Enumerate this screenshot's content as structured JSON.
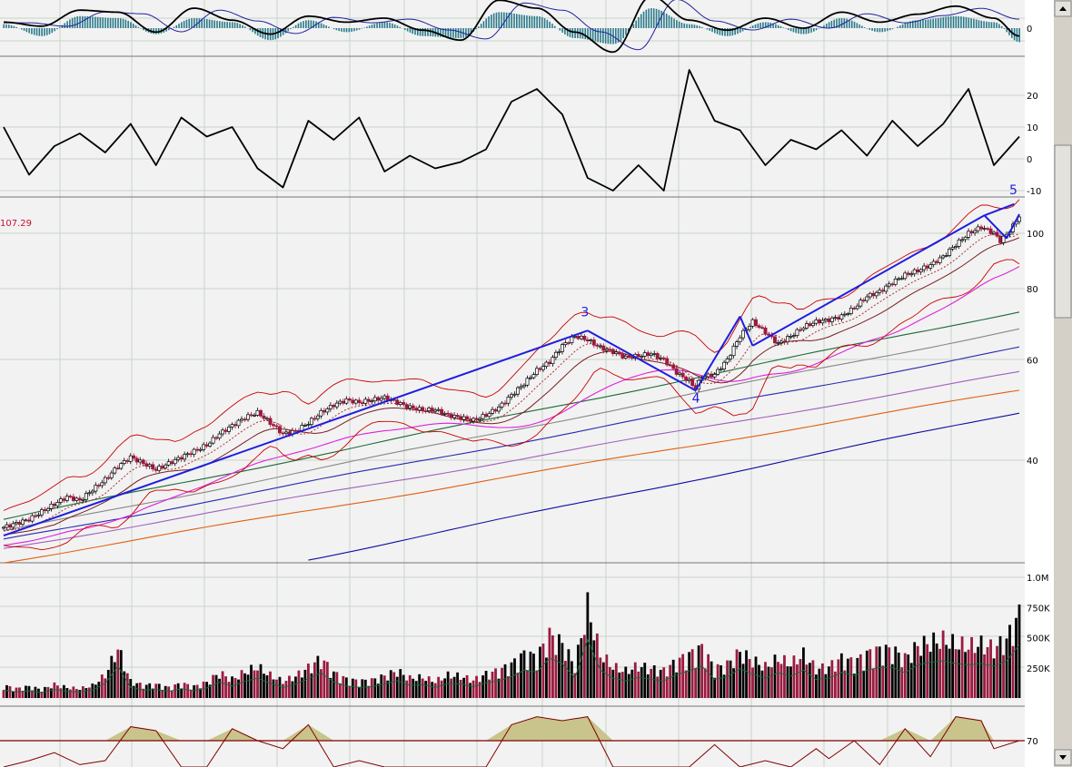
{
  "colors": {
    "background": "#f2f2f2",
    "grid": "#c8d4c8",
    "bull": "#000000",
    "bear": "#9b1b40",
    "trendline": "#1e1ee0",
    "bollinger": "#cc0000",
    "ma_short": "#7a1e1e",
    "ma_pink": "#dd22dd",
    "ma_green": "#1b6b3a",
    "ma_gray": "#888888",
    "ma_navy": "#2a2ab0",
    "ma_violet": "#a060c0",
    "ma_orange": "#e06010",
    "ma_blue": "#1010a0",
    "rsi_fill": "#c8c48c",
    "rsi_line": "#800000",
    "macd_hist": "#2a7a8a",
    "macd_signal": "#2020a0",
    "scroll_track": "#d4d0c8"
  },
  "chart_data": [
    {
      "type": "bar",
      "panel": "macd",
      "yticks": [
        "0"
      ],
      "x_days": [
        0,
        60,
        120,
        180,
        240,
        300,
        360,
        420,
        480,
        540,
        600,
        660,
        720,
        780,
        840,
        900,
        960,
        1020,
        1080,
        1140,
        1200,
        1260,
        1320,
        1380,
        1440,
        1500,
        1560,
        1600
      ],
      "histogram": [
        0.2,
        -0.4,
        0.6,
        0.5,
        -0.3,
        0.5,
        0.3,
        -0.6,
        0.4,
        -0.2,
        0.3,
        -0.4,
        -0.5,
        0.8,
        0.6,
        -0.5,
        -0.8,
        1.0,
        0.2,
        -0.4,
        0.3,
        -0.3,
        0.5,
        -0.2,
        0.4,
        0.6,
        0.3,
        -0.7
      ],
      "macd": [
        0.3,
        0.1,
        0.9,
        0.8,
        -0.2,
        1.0,
        0.4,
        -0.3,
        0.6,
        0.3,
        0.5,
        -0.1,
        -0.6,
        1.4,
        1.0,
        -0.2,
        -1.2,
        1.6,
        0.4,
        -0.1,
        0.5,
        0.0,
        0.8,
        0.3,
        0.7,
        1.1,
        0.5,
        -0.4
      ]
    },
    {
      "type": "line",
      "panel": "momentum",
      "yticks": [
        "20",
        "10",
        "0",
        "-10"
      ],
      "ylim": [
        -10,
        25
      ],
      "x_days": [
        0,
        40,
        80,
        120,
        160,
        200,
        240,
        280,
        320,
        360,
        400,
        440,
        480,
        520,
        560,
        600,
        640,
        680,
        720,
        760,
        800,
        840,
        880,
        920,
        960,
        1000,
        1040,
        1080,
        1120,
        1160,
        1200,
        1240,
        1280,
        1320,
        1360,
        1400,
        1440,
        1480,
        1520,
        1560,
        1600
      ],
      "values": [
        10,
        -5,
        4,
        8,
        2,
        11,
        -2,
        13,
        7,
        10,
        -3,
        -9,
        12,
        6,
        13,
        -4,
        1,
        -3,
        -1,
        3,
        18,
        22,
        14,
        -6,
        -10,
        -2,
        -10,
        28,
        12,
        9,
        -2,
        6,
        3,
        9,
        1,
        12,
        4,
        11,
        22,
        -2,
        7
      ]
    },
    {
      "type": "line",
      "panel": "price",
      "scale": "log",
      "ylim": [
        32,
        118
      ],
      "yticks": [
        "100",
        "80",
        "60",
        "40"
      ],
      "last_price_label": "107.29",
      "close": [
        [
          0,
          30.5
        ],
        [
          20,
          31
        ],
        [
          40,
          31.5
        ],
        [
          60,
          32.5
        ],
        [
          80,
          33.5
        ],
        [
          100,
          34.5
        ],
        [
          120,
          34.0
        ],
        [
          140,
          35.5
        ],
        [
          160,
          37.0
        ],
        [
          180,
          39.0
        ],
        [
          200,
          40.5
        ],
        [
          220,
          39.5
        ],
        [
          240,
          38.5
        ],
        [
          260,
          39.5
        ],
        [
          280,
          40.5
        ],
        [
          300,
          41.5
        ],
        [
          320,
          42.5
        ],
        [
          340,
          44.5
        ],
        [
          360,
          46.0
        ],
        [
          380,
          47.5
        ],
        [
          400,
          48.5
        ],
        [
          420,
          46.5
        ],
        [
          440,
          44.5
        ],
        [
          460,
          45.0
        ],
        [
          480,
          46.5
        ],
        [
          500,
          48.5
        ],
        [
          520,
          50.0
        ],
        [
          540,
          51.0
        ],
        [
          560,
          50.5
        ],
        [
          580,
          51.0
        ],
        [
          600,
          51.5
        ],
        [
          620,
          50.5
        ],
        [
          640,
          49.5
        ],
        [
          660,
          49.0
        ],
        [
          680,
          49.0
        ],
        [
          700,
          48.0
        ],
        [
          720,
          47.5
        ],
        [
          740,
          47.0
        ],
        [
          760,
          48.0
        ],
        [
          780,
          49.5
        ],
        [
          800,
          52.0
        ],
        [
          820,
          54.5
        ],
        [
          840,
          57.5
        ],
        [
          860,
          59.5
        ],
        [
          880,
          63.5
        ],
        [
          900,
          66.0
        ],
        [
          920,
          65.0
        ],
        [
          940,
          63.0
        ],
        [
          960,
          62.0
        ],
        [
          980,
          60.5
        ],
        [
          1000,
          61.0
        ],
        [
          1020,
          61.5
        ],
        [
          1040,
          60.0
        ],
        [
          1060,
          57.0
        ],
        [
          1080,
          55.0
        ],
        [
          1090,
          53.5
        ],
        [
          1100,
          56.0
        ],
        [
          1120,
          56.5
        ],
        [
          1140,
          60.0
        ],
        [
          1160,
          66.0
        ],
        [
          1180,
          70.0
        ],
        [
          1200,
          67.0
        ],
        [
          1220,
          64.0
        ],
        [
          1240,
          66.0
        ],
        [
          1260,
          68.5
        ],
        [
          1280,
          70.0
        ],
        [
          1300,
          70.5
        ],
        [
          1320,
          71.5
        ],
        [
          1340,
          74.0
        ],
        [
          1360,
          77.5
        ],
        [
          1380,
          79.0
        ],
        [
          1400,
          82.0
        ],
        [
          1420,
          84.5
        ],
        [
          1440,
          86.0
        ],
        [
          1460,
          88.0
        ],
        [
          1480,
          91.0
        ],
        [
          1500,
          95.5
        ],
        [
          1520,
          100.0
        ],
        [
          1540,
          102.5
        ],
        [
          1560,
          100.0
        ],
        [
          1570,
          97.0
        ],
        [
          1580,
          99.5
        ],
        [
          1590,
          103.0
        ],
        [
          1600,
          107.29
        ]
      ],
      "trendlines": [
        {
          "points": [
            [
              0,
              29.5
            ],
            [
              920,
              67.5
            ]
          ]
        },
        {
          "points": [
            [
              920,
              67.5
            ],
            [
              1090,
              53.0
            ]
          ]
        },
        {
          "points": [
            [
              1090,
              53.0
            ],
            [
              1160,
              71.5
            ]
          ]
        },
        {
          "points": [
            [
              1160,
              71.5
            ],
            [
              1180,
              63.5
            ]
          ]
        },
        {
          "points": [
            [
              1180,
              63.5
            ],
            [
              1545,
              107.5
            ]
          ]
        },
        {
          "points": [
            [
              1545,
              107.5
            ],
            [
              1580,
              98.0
            ]
          ]
        },
        {
          "points": [
            [
              1580,
              98.0
            ],
            [
              1600,
              108.0
            ]
          ]
        },
        {
          "points": [
            [
              1545,
              107.5
            ],
            [
              1592,
              112.5
            ]
          ]
        }
      ],
      "wave_labels": [
        {
          "text": "3",
          "x": 915,
          "y": 71.5
        },
        {
          "text": "4",
          "x": 1090,
          "y": 50.5
        },
        {
          "text": "5",
          "x": 1590,
          "y": 117.0
        }
      ],
      "ma_long": [
        {
          "color_key": "ma_green",
          "start": [
            0,
            31.5
          ],
          "end": [
            1600,
            73.0
          ]
        },
        {
          "color_key": "ma_gray",
          "start": [
            0,
            30.0
          ],
          "end": [
            1600,
            68.0
          ]
        },
        {
          "color_key": "ma_navy",
          "start": [
            0,
            29.0
          ],
          "end": [
            1600,
            63.0
          ]
        },
        {
          "color_key": "ma_violet",
          "start": [
            0,
            28.0
          ],
          "end": [
            1600,
            57.0
          ]
        },
        {
          "color_key": "ma_orange",
          "start": [
            0,
            26.5
          ],
          "end": [
            1600,
            53.0
          ]
        },
        {
          "color_key": "ma_blue",
          "start": [
            480,
            26.8
          ],
          "end": [
            1600,
            48.5
          ]
        }
      ]
    },
    {
      "type": "bar",
      "panel": "volume",
      "ylim": [
        0,
        1100
      ],
      "yticks": [
        "1.0M",
        "750K",
        "500K",
        "250K"
      ],
      "ytick_values": [
        1000,
        750,
        500,
        250
      ],
      "x_days": [
        0,
        20,
        40,
        60,
        80,
        100,
        120,
        140,
        160,
        180,
        200,
        220,
        240,
        260,
        280,
        300,
        320,
        340,
        360,
        380,
        400,
        420,
        440,
        460,
        480,
        500,
        520,
        540,
        560,
        580,
        600,
        620,
        640,
        660,
        680,
        700,
        720,
        740,
        760,
        780,
        800,
        820,
        840,
        860,
        880,
        900,
        920,
        940,
        960,
        980,
        1000,
        1020,
        1040,
        1060,
        1080,
        1100,
        1120,
        1140,
        1160,
        1180,
        1200,
        1220,
        1240,
        1260,
        1280,
        1300,
        1320,
        1340,
        1360,
        1380,
        1400,
        1420,
        1440,
        1460,
        1480,
        1500,
        1520,
        1540,
        1560,
        1580,
        1600
      ],
      "values_k": [
        120,
        90,
        110,
        80,
        130,
        100,
        90,
        120,
        220,
        480,
        160,
        120,
        130,
        100,
        140,
        110,
        150,
        240,
        180,
        250,
        300,
        220,
        160,
        210,
        290,
        380,
        240,
        180,
        160,
        170,
        210,
        260,
        190,
        200,
        160,
        220,
        210,
        170,
        230,
        260,
        320,
        420,
        390,
        600,
        520,
        300,
        880,
        420,
        300,
        260,
        310,
        280,
        260,
        350,
        410,
        480,
        280,
        320,
        440,
        360,
        300,
        380,
        330,
        420,
        280,
        300,
        380,
        340,
        420,
        460,
        460,
        380,
        500,
        540,
        560,
        520,
        500,
        520,
        480,
        560,
        800
      ],
      "up": [
        true,
        false,
        true,
        true,
        false,
        true,
        false,
        true,
        false,
        true,
        true,
        false,
        true,
        false,
        true,
        false,
        true,
        true,
        false,
        true,
        false,
        true,
        false,
        true,
        true,
        false,
        true,
        false,
        true,
        false,
        true,
        true,
        false,
        true,
        false,
        true,
        true,
        false,
        true,
        false,
        true,
        true,
        true,
        false,
        true,
        true,
        true,
        false,
        false,
        true,
        false,
        true,
        false,
        true,
        false,
        false,
        true,
        true,
        true,
        false,
        true,
        false,
        true,
        false,
        true,
        true,
        false,
        true,
        true,
        false,
        true,
        false,
        true,
        true,
        false,
        true,
        false,
        true,
        false,
        true,
        true
      ]
    },
    {
      "type": "area",
      "panel": "rsi",
      "yticks": [
        "70"
      ],
      "threshold": 70,
      "ylim": [
        40,
        85
      ],
      "x_days": [
        0,
        40,
        80,
        120,
        160,
        200,
        240,
        280,
        320,
        360,
        400,
        440,
        480,
        520,
        560,
        600,
        640,
        680,
        720,
        760,
        800,
        840,
        880,
        920,
        960,
        1000,
        1040,
        1080,
        1120,
        1160,
        1200,
        1240,
        1280,
        1300,
        1340,
        1380,
        1420,
        1460,
        1500,
        1540,
        1560,
        1600
      ],
      "values": [
        55,
        60,
        64,
        58,
        60,
        77,
        75,
        52,
        49,
        76,
        70,
        66,
        78,
        55,
        60,
        50,
        48,
        42,
        44,
        47,
        78,
        82,
        80,
        82,
        55,
        52,
        45,
        44,
        68,
        52,
        60,
        55,
        66,
        61,
        70,
        58,
        76,
        62,
        82,
        80,
        66,
        70
      ]
    }
  ]
}
